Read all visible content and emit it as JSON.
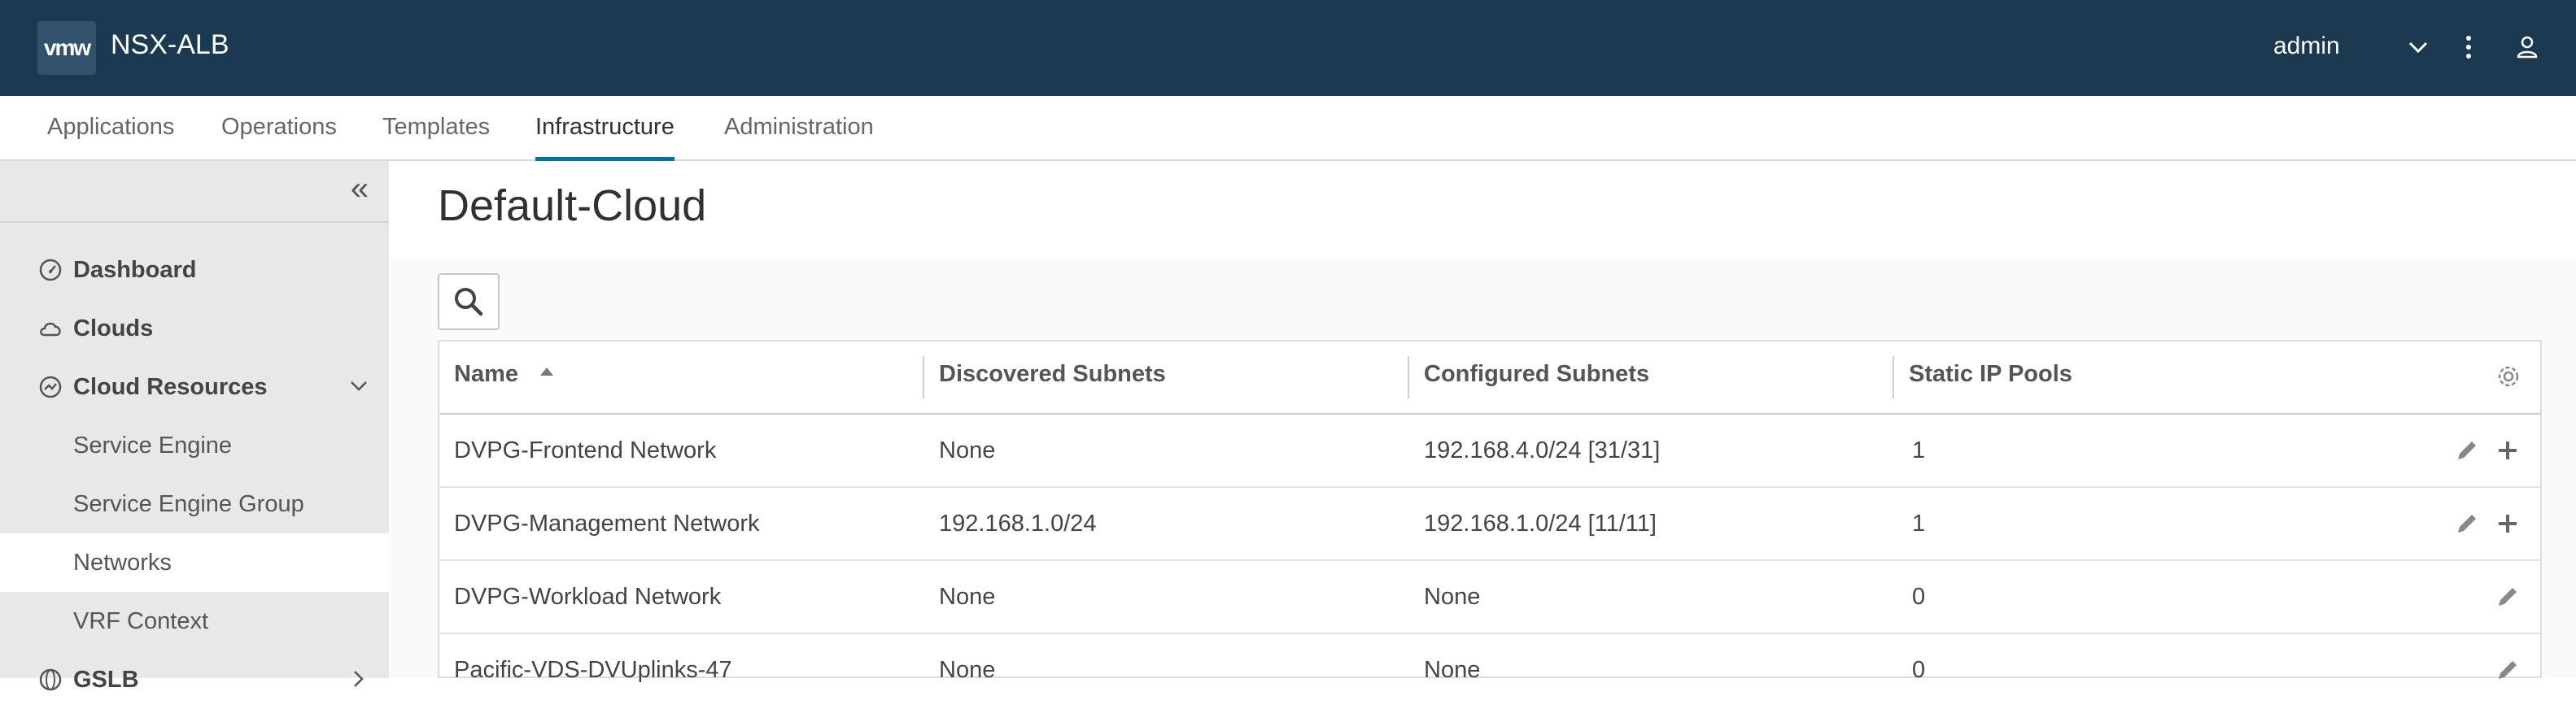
{
  "header": {
    "logo": "vmw",
    "title": "NSX-ALB",
    "user": "admin"
  },
  "nav": {
    "tabs": [
      {
        "label": "Applications"
      },
      {
        "label": "Operations"
      },
      {
        "label": "Templates"
      },
      {
        "label": "Infrastructure",
        "active": true
      },
      {
        "label": "Administration"
      }
    ]
  },
  "sidebar": {
    "items": [
      {
        "label": "Dashboard",
        "icon": "dashboard-icon"
      },
      {
        "label": "Clouds",
        "icon": "cloud-icon"
      },
      {
        "label": "Cloud Resources",
        "icon": "cloud-resources-icon",
        "expanded": true
      },
      {
        "label": "Service Engine"
      },
      {
        "label": "Service Engine Group"
      },
      {
        "label": "Networks",
        "selected": true
      },
      {
        "label": "VRF Context"
      },
      {
        "label": "GSLB",
        "icon": "gslb-icon"
      }
    ]
  },
  "main": {
    "title": "Default-Cloud",
    "columns": [
      "Name",
      "Discovered Subnets",
      "Configured Subnets",
      "Static IP Pools"
    ],
    "rows": [
      {
        "name": "DVPG-Frontend Network",
        "discovered": "None",
        "configured": "192.168.4.0/24 [31/31]",
        "pools": "1",
        "actions": [
          "edit",
          "add"
        ]
      },
      {
        "name": "DVPG-Management Network",
        "discovered": "192.168.1.0/24",
        "configured": "192.168.1.0/24 [11/11]",
        "pools": "1",
        "actions": [
          "edit",
          "add"
        ]
      },
      {
        "name": "DVPG-Workload Network",
        "discovered": "None",
        "configured": "None",
        "pools": "0",
        "actions": [
          "edit"
        ]
      },
      {
        "name": "Pacific-VDS-DVUplinks-47",
        "discovered": "None",
        "configured": "None",
        "pools": "0",
        "actions": [
          "edit"
        ]
      }
    ]
  },
  "colors": {
    "header_bg": "#1b3a52",
    "accent": "#0072a3",
    "sidebar_bg": "#e8e8e8"
  }
}
